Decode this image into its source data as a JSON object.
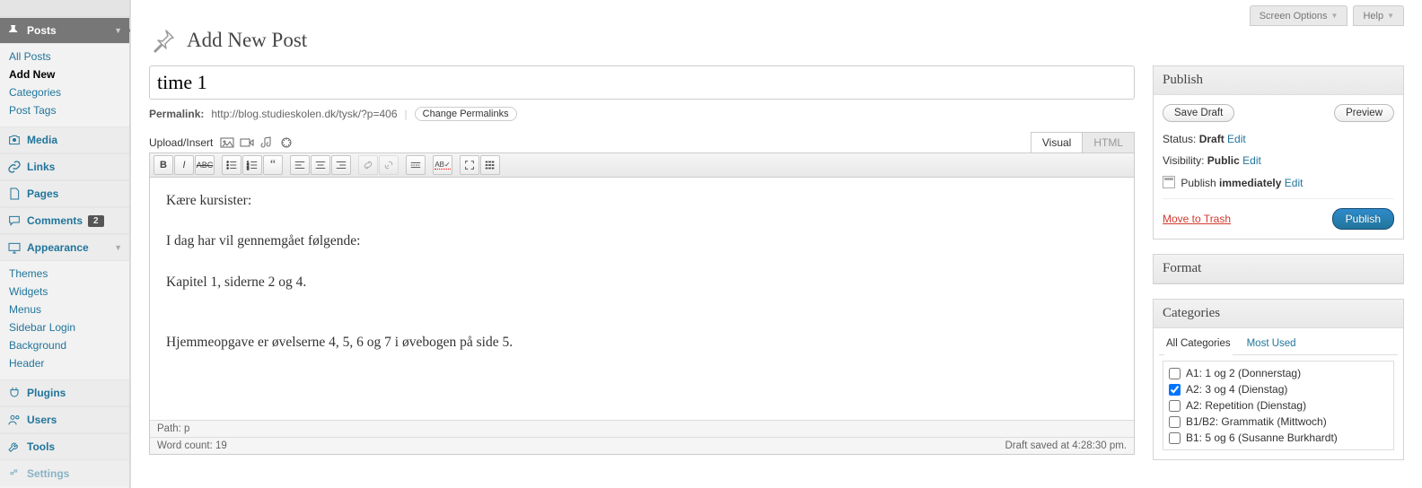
{
  "header": {
    "screen_options": "Screen Options",
    "help": "Help"
  },
  "sidebar": {
    "posts": {
      "label": "Posts",
      "items": [
        "All Posts",
        "Add New",
        "Categories",
        "Post Tags"
      ],
      "current_item": 1
    },
    "media": "Media",
    "links": "Links",
    "pages": "Pages",
    "comments": "Comments",
    "comments_count": "2",
    "appearance": {
      "label": "Appearance",
      "items": [
        "Themes",
        "Widgets",
        "Menus",
        "Sidebar Login",
        "Background",
        "Header"
      ]
    },
    "plugins": "Plugins",
    "users": "Users",
    "tools": "Tools",
    "settings": "Settings"
  },
  "page": {
    "title": "Add New Post",
    "post_title_value": "time 1",
    "permalink_label": "Permalink:",
    "permalink_url": "http://blog.studieskolen.dk/tysk/?p=406",
    "change_permalinks": "Change Permalinks",
    "upload_insert": "Upload/Insert",
    "visual_tab": "Visual",
    "html_tab": "HTML",
    "content_p1": "Kære kursister:",
    "content_p2": "I dag har vil gennemgået følgende:",
    "content_p3": "Kapitel 1, siderne 2 og 4.",
    "content_p4": "Hjemmeopgave er øvelserne 4, 5, 6 og 7 i øvebogen på side 5.",
    "path": "Path: p",
    "word_count_label": "Word count: ",
    "word_count": "19",
    "draft_saved": "Draft saved at 4:28:30 pm."
  },
  "publish": {
    "heading": "Publish",
    "save_draft": "Save Draft",
    "preview": "Preview",
    "status_label": "Status: ",
    "status_value": "Draft",
    "visibility_label": "Visibility: ",
    "visibility_value": "Public",
    "publish_label": "Publish ",
    "publish_value": "immediately",
    "edit": "Edit",
    "move_to_trash": "Move to Trash",
    "publish_button": "Publish"
  },
  "format": {
    "heading": "Format"
  },
  "categories": {
    "heading": "Categories",
    "tab_all": "All Categories",
    "tab_most": "Most Used",
    "items": [
      {
        "label": "A1: 1 og 2 (Donnerstag)",
        "checked": false
      },
      {
        "label": "A2: 3 og 4 (Dienstag)",
        "checked": true
      },
      {
        "label": "A2: Repetition (Dienstag)",
        "checked": false
      },
      {
        "label": "B1/B2: Grammatik (Mittwoch)",
        "checked": false
      },
      {
        "label": "B1: 5 og 6 (Susanne Burkhardt)",
        "checked": false
      }
    ]
  }
}
